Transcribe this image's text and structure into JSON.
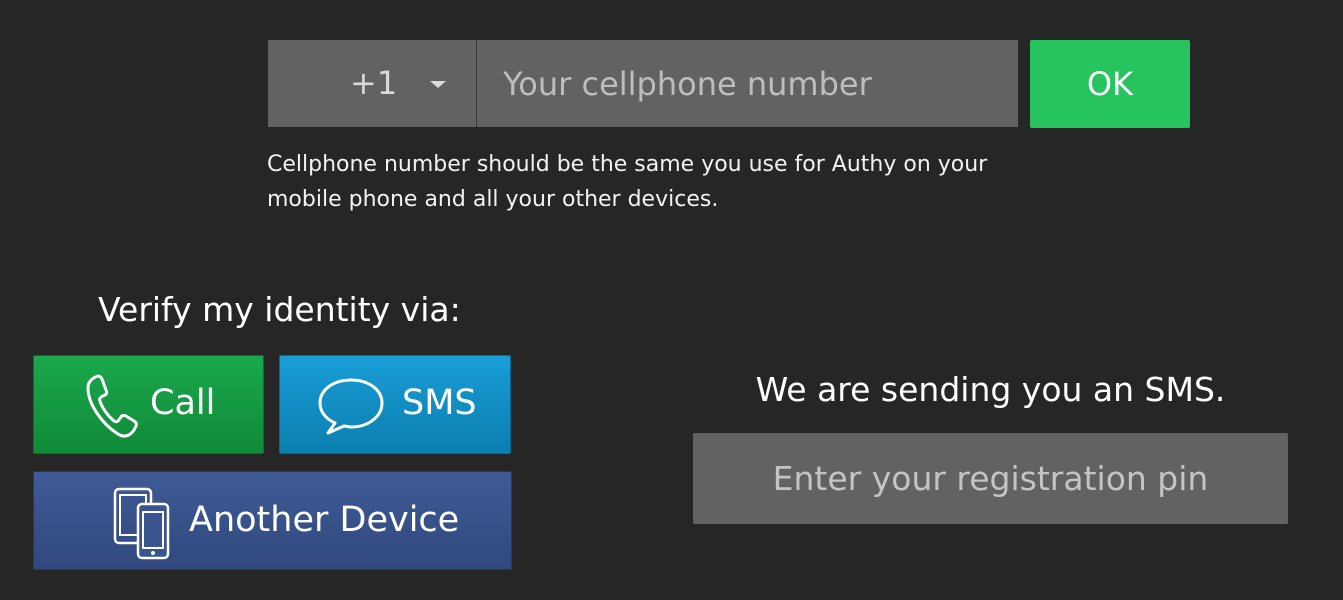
{
  "phone": {
    "country_code": "+1",
    "placeholder": "Your cellphone number",
    "value": "",
    "ok_label": "OK",
    "hint": "Cellphone number should be the same you use for Authy on your mobile phone and all your other devices."
  },
  "verify": {
    "title": "Verify my identity via:",
    "methods": [
      {
        "label": "Call",
        "icon": "phone-icon",
        "color": "#1aa84b"
      },
      {
        "label": "SMS",
        "icon": "speech-bubble-icon",
        "color": "#189ed6"
      },
      {
        "label": "Another Device",
        "icon": "devices-icon",
        "color": "#3f5b96"
      }
    ]
  },
  "sms": {
    "status": "We are sending you an SMS.",
    "pin_placeholder": "Enter your registration pin",
    "pin_value": ""
  },
  "colors": {
    "background": "#262626",
    "field": "#626262",
    "ok": "#26c35e"
  }
}
